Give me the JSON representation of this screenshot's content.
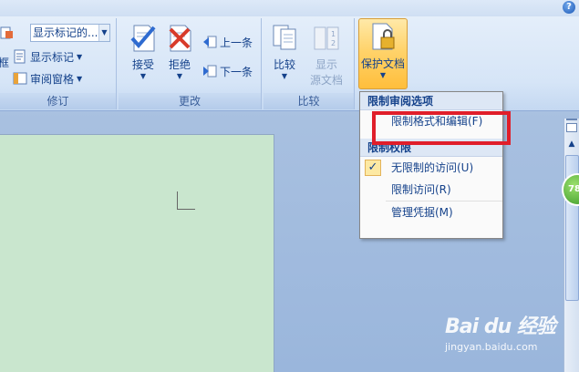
{
  "help": {
    "icon": "help-icon",
    "glyph": "?"
  },
  "ribbon": {
    "tracking_group": {
      "label": "修订",
      "combo_value": "显示标记的...",
      "show_markup": "显示标记",
      "reviewing_pane": "审阅窗格",
      "left_fragment": "框"
    },
    "changes_group": {
      "label": "更改",
      "accept": "接受",
      "reject": "拒绝",
      "previous": "上一条",
      "next": "下一条"
    },
    "compare_group": {
      "label": "比较",
      "compare": "比较",
      "show_source_line1": "显示",
      "show_source_line2": "源文档"
    },
    "protect_group": {
      "protect_document": "保护文档"
    }
  },
  "menu": {
    "heading1": "限制审阅选项",
    "item_restrict_formatting": "限制格式和编辑(F)",
    "heading2": "限制权限",
    "item_unrestricted": "无限制的访问(U)",
    "item_restricted": "限制访问(R)",
    "item_manage": "管理凭据(M)"
  },
  "scroll": {
    "badge": "78"
  },
  "watermark": {
    "logo": "Bai du 经验",
    "url": "jingyan.baidu.com"
  },
  "colors": {
    "accent": "#15428b",
    "highlight": "#e01e2a",
    "page": "#c9e6ce"
  }
}
